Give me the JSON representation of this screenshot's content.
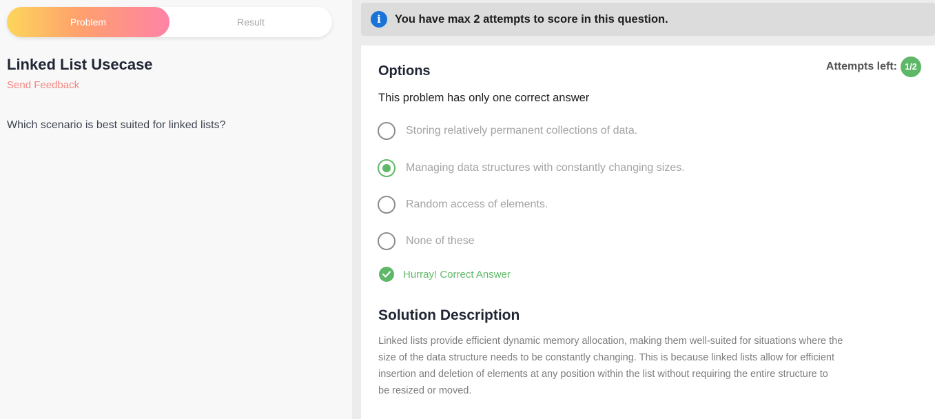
{
  "tabs": {
    "problem_label": "Problem",
    "result_label": "Result"
  },
  "problem": {
    "title": "Linked List Usecase",
    "feedback_link": "Send Feedback",
    "question": "Which scenario is best suited for linked lists?"
  },
  "notice": {
    "icon": "info-icon",
    "text": "You have max 2 attempts to score in this question."
  },
  "options_panel": {
    "title": "Options",
    "attempts_label": "Attempts left:",
    "attempts_value": "1/2",
    "hint": "This problem has only one correct answer",
    "options": [
      {
        "label": "Storing relatively permanent collections of data.",
        "selected": false
      },
      {
        "label": "Managing data structures with constantly changing sizes.",
        "selected": true
      },
      {
        "label": "Random access of elements.",
        "selected": false
      },
      {
        "label": "None of these",
        "selected": false
      }
    ],
    "feedback": "Hurray! Correct Answer"
  },
  "solution": {
    "title": "Solution Description",
    "lines": [
      "Linked lists provide efficient dynamic memory allocation, making them well-suited for situations where the",
      "size of the data structure needs to be constantly changing. This is because linked lists allow for efficient",
      "insertion and deletion of elements at any position within the list without requiring the entire structure to",
      "be resized or moved."
    ]
  },
  "colors": {
    "accent_green": "#5fb868",
    "link_pink": "#f4857f",
    "info_blue": "#1a73d9"
  }
}
